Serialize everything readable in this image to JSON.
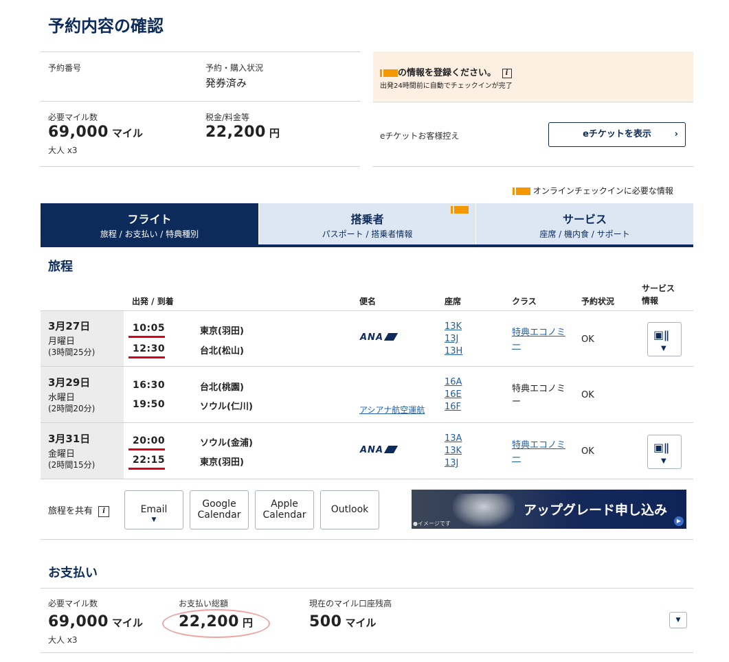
{
  "page_title": "予約内容の確認",
  "summary": {
    "booking_number_label": "予約番号",
    "booking_number_value": "",
    "status_label": "予約・購入状況",
    "status_value": "発券済み",
    "miles_label": "必要マイル数",
    "miles_value": "69,000",
    "miles_unit": "マイル",
    "passengers": "大人 x3",
    "tax_label": "税金/料金等",
    "tax_value": "22,200",
    "tax_unit": "円"
  },
  "notice": {
    "title": "の情報を登録ください。",
    "subtitle": "出発24時間前に自動でチェックインが完了"
  },
  "eticket": {
    "label": "eチケットお客様控え",
    "button": "eチケットを表示"
  },
  "checkin_legend": "オンラインチェックインに必要な情報",
  "tabs": [
    {
      "title": "フライト",
      "sub": "旅程 / お支払い / 特典種別"
    },
    {
      "title": "搭乗者",
      "sub": "パスポート / 搭乗者情報"
    },
    {
      "title": "サービス",
      "sub": "座席 / 機内食 / サポート"
    }
  ],
  "itinerary": {
    "heading": "旅程",
    "columns": {
      "dep_arr": "出発 / 到着",
      "flight": "便名",
      "seats": "座席",
      "class": "クラス",
      "status": "予約状況",
      "service": "サービス 情報"
    },
    "rows": [
      {
        "date": "3月27日",
        "weekday": "月曜日",
        "duration": "(3時間25分)",
        "dep_time": "10:05",
        "dep_city": "東京(羽田)",
        "arr_time": "12:30",
        "arr_city": "台北(松山)",
        "airline": "ANA",
        "operator": "",
        "seats": [
          "13K",
          "13J",
          "13H"
        ],
        "class": "特典エコノミー",
        "status": "OK"
      },
      {
        "date": "3月29日",
        "weekday": "水曜日",
        "duration": "(2時間20分)",
        "dep_time": "16:30",
        "dep_city": "台北(桃園)",
        "arr_time": "19:50",
        "arr_city": "ソウル(仁川)",
        "airline": "",
        "operator": "アシアナ航空運航",
        "seats": [
          "16A",
          "16E",
          "16F"
        ],
        "class": "特典エコノミー",
        "status": "OK"
      },
      {
        "date": "3月31日",
        "weekday": "金曜日",
        "duration": "(2時間15分)",
        "dep_time": "20:00",
        "dep_city": "ソウル(金浦)",
        "arr_time": "22:15",
        "arr_city": "東京(羽田)",
        "airline": "ANA",
        "operator": "",
        "seats": [
          "13A",
          "13K",
          "13J"
        ],
        "class": "特典エコノミー",
        "status": "OK"
      }
    ]
  },
  "share": {
    "label": "旅程を共有",
    "buttons": [
      "Email",
      "Google Calendar",
      "Apple Calendar",
      "Outlook"
    ]
  },
  "banner": {
    "text": "アップグレード申し込み",
    "caption": "●イメージです"
  },
  "payment": {
    "heading": "お支払い",
    "miles_label": "必要マイル数",
    "miles_value": "69,000",
    "miles_unit": "マイル",
    "passengers": "大人 x3",
    "total_label": "お支払い総額",
    "total_value": "22,200",
    "total_unit": "円",
    "balance_label": "現在のマイル口座残高",
    "balance_value": "500",
    "balance_unit": "マイル"
  },
  "colors": {
    "navy": "#0c2b5b",
    "orange": "#f39800",
    "link": "#1f5fa8",
    "red": "#d9001b",
    "tab_inactive": "#dde7f4",
    "notice_bg": "#fdf0e2"
  }
}
